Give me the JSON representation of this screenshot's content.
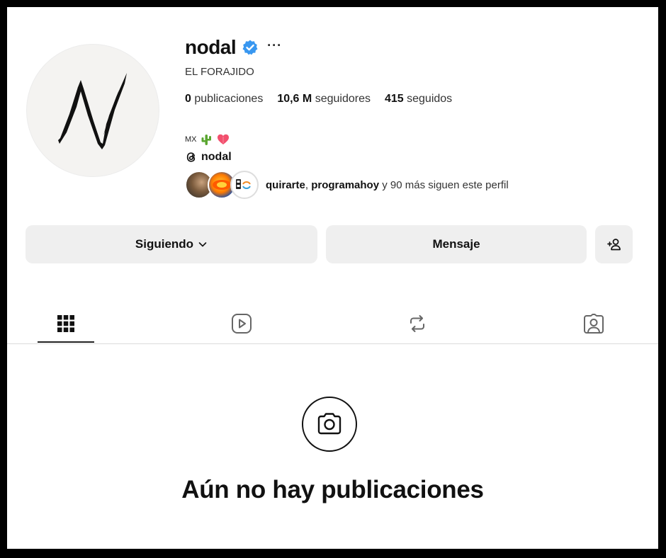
{
  "profile": {
    "username": "nodal",
    "full_name": "EL FORAJIDO",
    "more_label": "···",
    "bio_code": "MX",
    "threads_handle": "nodal"
  },
  "stats": [
    {
      "value": "0",
      "label": "publicaciones"
    },
    {
      "value": "10,6 M",
      "label": "seguidores"
    },
    {
      "value": "415",
      "label": "seguidos"
    }
  ],
  "followed_by": {
    "user1": "quirarte",
    "separator": ", ",
    "user2": "programahoy",
    "suffix": " y 90 más siguen este perfil"
  },
  "buttons": {
    "following": "Siguiendo",
    "message": "Mensaje"
  },
  "tabs": [
    {
      "icon": "grid-icon",
      "active": true
    },
    {
      "icon": "reels-icon",
      "active": false
    },
    {
      "icon": "reposts-icon",
      "active": false
    },
    {
      "icon": "tagged-icon",
      "active": false
    }
  ],
  "empty_state": {
    "title": "Aún no hay publicaciones",
    "icon": "camera-icon"
  },
  "colors": {
    "verified": "#3897f0",
    "button_bg": "#efefef",
    "text_primary": "#111111"
  }
}
